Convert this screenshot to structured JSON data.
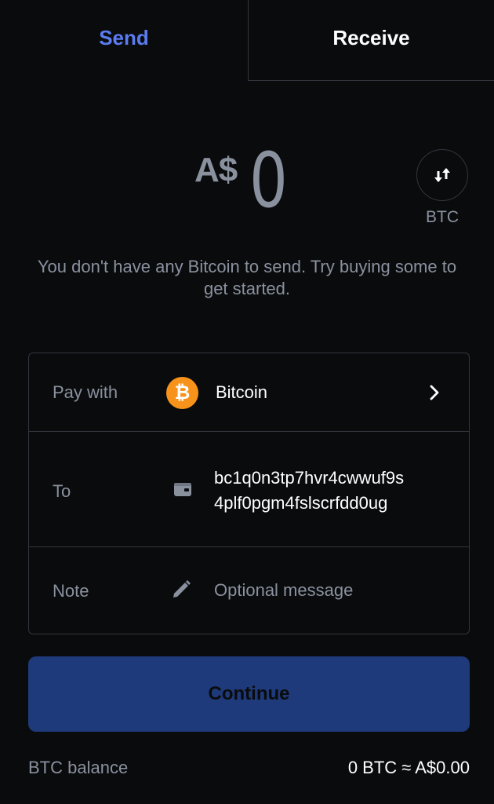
{
  "tabs": {
    "send": "Send",
    "receive": "Receive",
    "active": "send"
  },
  "amount": {
    "currency": "A$",
    "value": "0"
  },
  "switch": {
    "label": "BTC",
    "icon": "swap-arrows-icon"
  },
  "info_text": "You don't have any Bitcoin to send. Try buying some to get started.",
  "form": {
    "pay_with": {
      "label": "Pay with",
      "asset": "Bitcoin",
      "asset_symbol": "₿",
      "asset_color": "#f7931a"
    },
    "to": {
      "label": "To",
      "address_line1": "bc1q0n3tp7hvr4cwwuf9s",
      "address_line2": "4plf0pgm4fslscrfdd0ug"
    },
    "note": {
      "label": "Note",
      "placeholder": "Optional message",
      "value": ""
    }
  },
  "continue_label": "Continue",
  "balance": {
    "label": "BTC balance",
    "value": "0 BTC ≈ A$0.00"
  },
  "colors": {
    "background": "#0a0b0d",
    "accent": "#5b7cf0",
    "button_disabled": "#1e3a7a",
    "muted_text": "#8a919e",
    "border": "#32353d"
  }
}
